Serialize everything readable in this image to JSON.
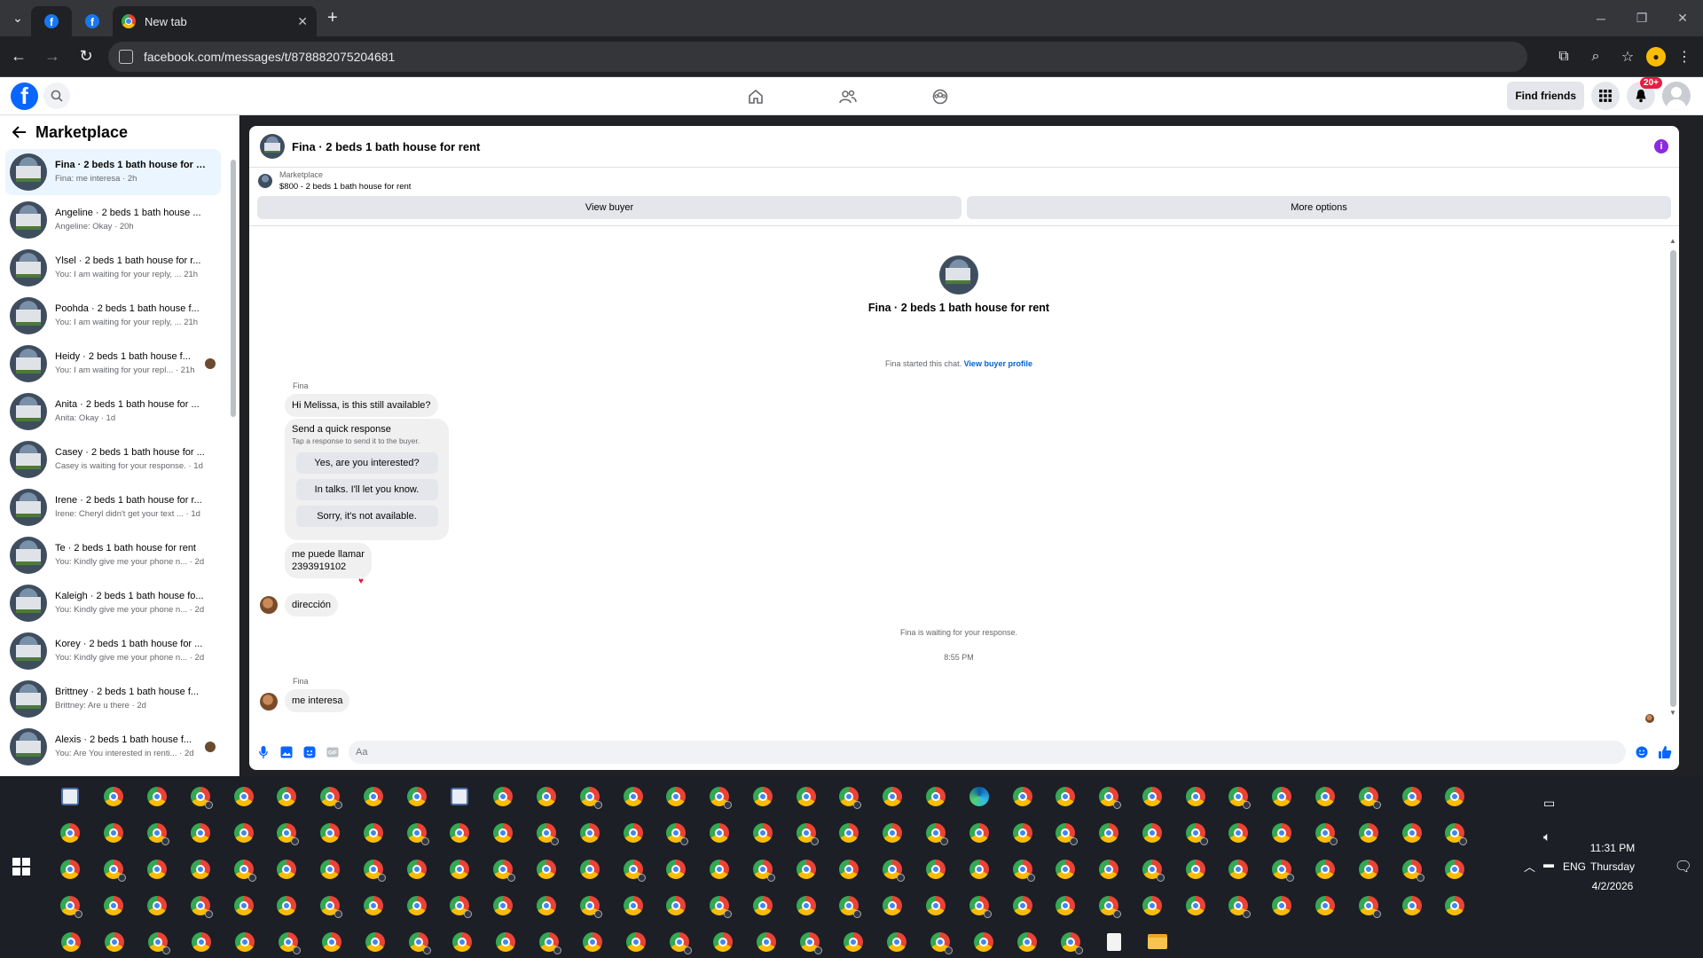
{
  "browser": {
    "tabs": [
      {
        "type": "facebook",
        "active": true
      },
      {
        "type": "facebook",
        "active": false
      },
      {
        "type": "newtab",
        "title": "New tab"
      }
    ],
    "url": "facebook.com/messages/t/878882075204681"
  },
  "fb_header": {
    "find_friends_label": "Find friends",
    "notification_badge": "20+"
  },
  "sidebar": {
    "title": "Marketplace",
    "conversations": [
      {
        "name": "Fina · 2 beds 1 bath house for r...",
        "sub": "Fina: me interesa · 2h",
        "active": true,
        "bold": true
      },
      {
        "name": "Angeline · 2 beds 1 bath house ...",
        "sub": "Angeline: Okay · 20h"
      },
      {
        "name": "Ylsel · 2 beds 1 bath house for r...",
        "sub": "You: I am waiting for your reply, ...   21h"
      },
      {
        "name": "Poohda · 2 beds 1 bath house f...",
        "sub": "You: I am waiting for your reply, ...  21h"
      },
      {
        "name": "Heidy · 2 beds 1 bath house f...",
        "sub": "You: I am waiting for your repl... · 21h",
        "avatar": true
      },
      {
        "name": "Anita · 2 beds 1 bath house for ...",
        "sub": "Anita: Okay · 1d"
      },
      {
        "name": "Casey · 2 beds 1 bath house for ...",
        "sub": "Casey is waiting for your response. · 1d"
      },
      {
        "name": "Irene · 2 beds 1 bath house for r...",
        "sub": "Irene: Cheryl didn't get your text ...  · 1d"
      },
      {
        "name": "Te · 2 beds 1 bath house for rent",
        "sub": "You: Kindly give me your phone n... · 2d"
      },
      {
        "name": "Kaleigh · 2 beds 1 bath house fo...",
        "sub": "You: Kindly give me your phone n... · 2d"
      },
      {
        "name": "Korey · 2 beds 1 bath house for ...",
        "sub": "You: Kindly give me your phone n... · 2d"
      },
      {
        "name": "Brittney · 2 beds 1 bath house f...",
        "sub": "Brittney: Are u there · 2d"
      },
      {
        "name": "Alexis · 2 beds 1 bath house f...",
        "sub": "You: Are You interested in renti... · 2d",
        "avatar": true
      }
    ]
  },
  "chat": {
    "title": "Fina · 2 beds 1 bath house for rent",
    "listing_label": "Marketplace",
    "listing_price": "$800 - 2 beds 1 bath house for rent",
    "view_buyer": "View buyer",
    "more_options": "More options",
    "center_title": "Fina · 2 beds 1 bath house for rent",
    "started_text": "Fina started this chat.",
    "view_buyer_profile": "View buyer profile",
    "sender_name": "Fina",
    "msg1": "Hi Melissa, is this still available?",
    "quick_title": "Send a quick response",
    "quick_sub": "Tap a response to send it to the buyer.",
    "quick_responses": [
      "Yes, are you interested?",
      "In talks. I'll let you know.",
      "Sorry, it's not available."
    ],
    "msg2_line1": "me puede llamar",
    "msg2_line2": "2393919102",
    "msg3": "dirección",
    "waiting_text": "Fina is waiting for your response.",
    "time_stamp": "8:55 PM",
    "sender_name2": "Fina",
    "msg4": "me interesa",
    "composer_placeholder": "Aa"
  },
  "taskbar": {
    "time": "11:31 PM",
    "day": "Thursday",
    "date": "4/2/2026",
    "lang": "ENG"
  }
}
